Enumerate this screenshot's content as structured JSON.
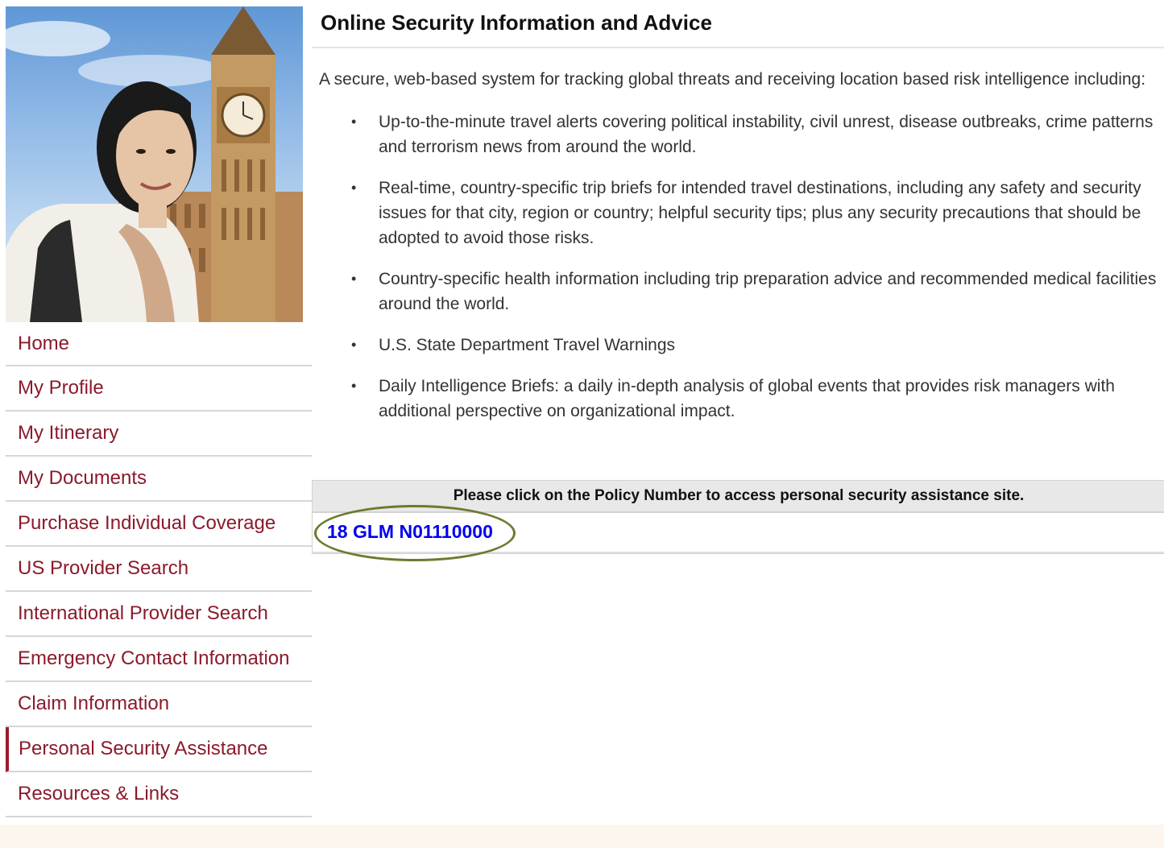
{
  "page": {
    "title": "Online Security Information and Advice"
  },
  "intro": "A secure, web-based system for tracking global threats and receiving location based risk intelligence including:",
  "bullets": [
    "Up-to-the-minute travel alerts covering political instability, civil unrest, disease outbreaks, crime patterns and terrorism news from around the world.",
    "Real-time, country-specific trip briefs for intended travel destinations, including any safety and security issues for that city, region or country; helpful security tips; plus any security precautions that should be adopted to avoid those risks.",
    "Country-specific health information including trip preparation advice and recommended medical facilities around the world.",
    "U.S. State Department Travel Warnings",
    "Daily Intelligence Briefs: a daily in-depth analysis of global events that provides risk managers with additional perspective on organizational impact."
  ],
  "bullet_glyph": "•",
  "policy": {
    "header": "Please click on the Policy Number to access personal security assistance site.",
    "number": "18 GLM N01110000"
  },
  "sidebar": {
    "items": [
      {
        "label": "Home"
      },
      {
        "label": "My Profile"
      },
      {
        "label": "My Itinerary"
      },
      {
        "label": "My Documents"
      },
      {
        "label": "Purchase Individual Coverage"
      },
      {
        "label": "US Provider Search"
      },
      {
        "label": "International Provider Search"
      },
      {
        "label": "Emergency Contact Information"
      },
      {
        "label": "Claim Information"
      },
      {
        "label": "Personal Security Assistance"
      },
      {
        "label": "Resources & Links"
      }
    ],
    "active_index": 9
  },
  "colors": {
    "nav_text": "#8b1a2b",
    "active_marker": "#9b1b30",
    "link": "#0000ee",
    "highlight_oval": "#6a7b2f"
  }
}
